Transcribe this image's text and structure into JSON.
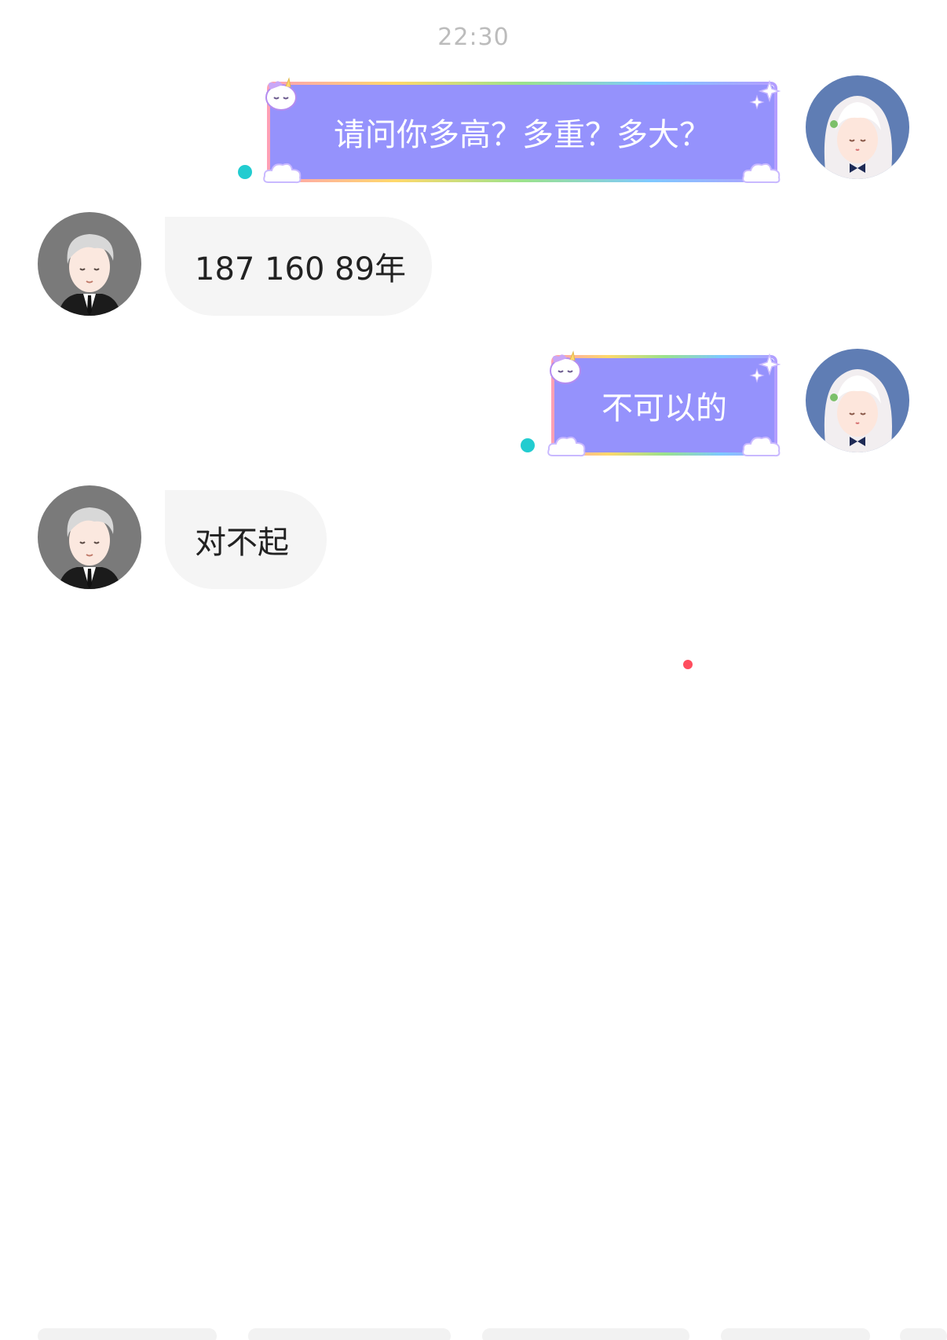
{
  "chat": {
    "timestamp": "22:30",
    "messages": [
      {
        "sender": "me",
        "text": "请问你多高？多重？多大？"
      },
      {
        "sender": "other",
        "text": "187 160 89年"
      },
      {
        "sender": "me",
        "text": "不可以的"
      },
      {
        "sender": "other",
        "text": "对不起"
      }
    ]
  },
  "colors": {
    "my_bubble": "#9592fc",
    "other_bubble": "#f5f5f5",
    "read_dot": "#22ccd0",
    "notification_dot": "#ff4d5e",
    "my_avatar_bg": "#5f7db4",
    "other_avatar_bg": "#7a7a7a"
  },
  "icons": {
    "my_avatar": "anime-girl-avatar",
    "other_avatar": "suited-man-avatar",
    "bubble_decorations": [
      "unicorn-icon",
      "sparkle-icon",
      "cloud-icon"
    ]
  }
}
